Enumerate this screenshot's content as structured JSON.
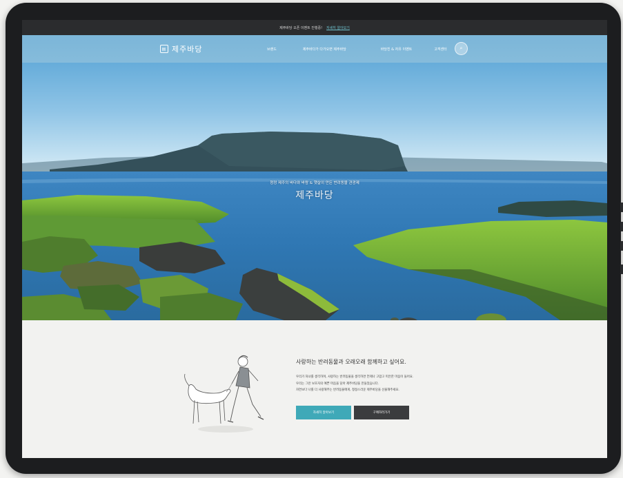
{
  "notice_bar": {
    "text": "제주바당 오픈 이벤트 진행중!",
    "link": "자세히 알아보기"
  },
  "nav": {
    "logo": "제주바당",
    "items": [
      "브랜드",
      "제주바다가 다가오면 제주바당",
      "바당친 & 자유 이벤트",
      "고객센터"
    ],
    "search_icon": "search-icon"
  },
  "hero": {
    "caption": "청정 제주의 바다와 바람 & 햇살이 만든 반려동물 관광제",
    "title": "제주바당"
  },
  "intro": {
    "headline": "사랑하는 반려동물과 오래오래 함께하고 싶어요.",
    "paragraphs": [
      "우리가 처녀를 생각하며, 사랑하는 반려동물을 생각하면 언제나 고맙고 미안한 마음이 들어요.",
      "우리는 그런 보호자의 예쁜 마음을 담아 제주바당을 만들었습니다.",
      "자연보다 나를 더 사랑해주는 반려동물에게, 청정스러운 제주바당을 선물해주세요."
    ],
    "primary_button": "자세히 알아보기",
    "secondary_button": "구매하러가기"
  }
}
